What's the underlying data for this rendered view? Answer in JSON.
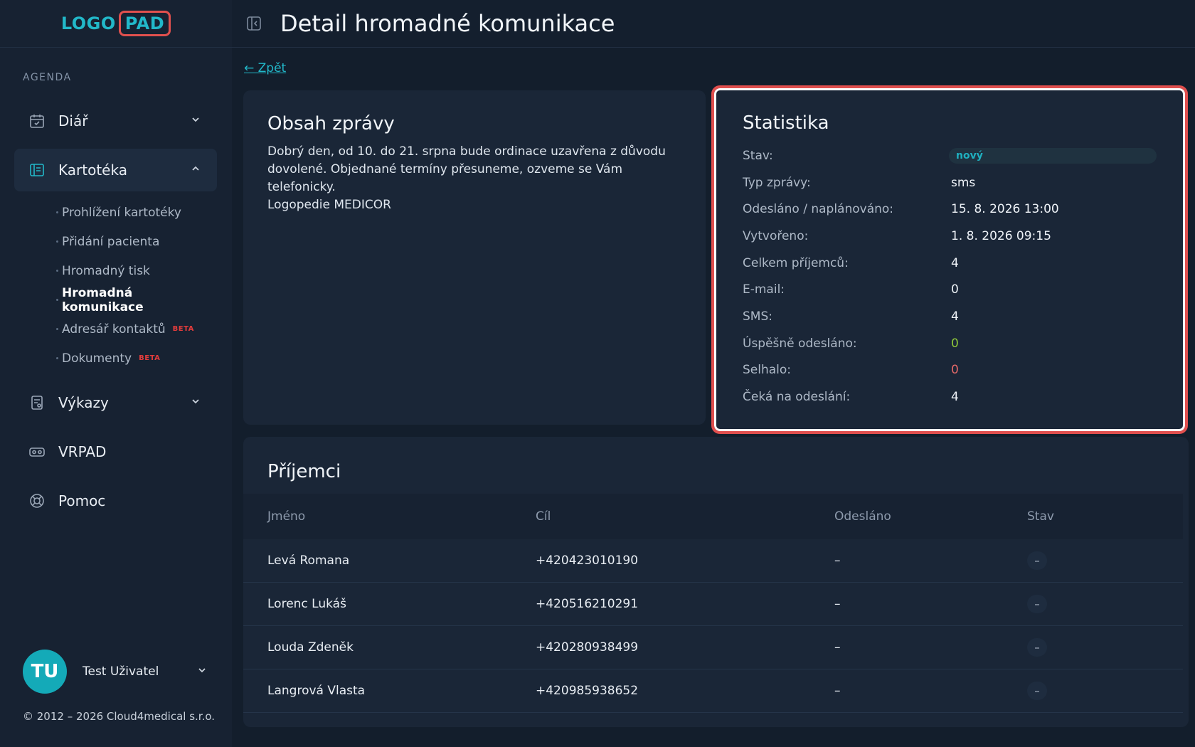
{
  "logo": {
    "left": "LOGO",
    "right": "PAD"
  },
  "sidebar": {
    "section_label": "AGENDA",
    "items": [
      {
        "label": "Diář",
        "icon": "calendar-icon"
      },
      {
        "label": "Kartotéka",
        "icon": "file-cabinet-icon"
      },
      {
        "label": "Výkazy",
        "icon": "report-icon"
      },
      {
        "label": "VRPAD",
        "icon": "vr-headset-icon"
      },
      {
        "label": "Pomoc",
        "icon": "lifebuoy-icon"
      }
    ],
    "subitems": [
      {
        "label": "Prohlížení kartotéky"
      },
      {
        "label": "Přidání pacienta"
      },
      {
        "label": "Hromadný tisk"
      },
      {
        "label": "Hromadná komunikace"
      },
      {
        "label": "Adresář kontaktů",
        "badge": "BETA"
      },
      {
        "label": "Dokumenty",
        "badge": "BETA"
      }
    ]
  },
  "user": {
    "initials": "TU",
    "name": "Test Uživatel"
  },
  "footer": "© 2012 – 2026 Cloud4medical s.r.o.",
  "header": {
    "title": "Detail hromadné komunikace"
  },
  "back": "← Zpět",
  "message": {
    "title": "Obsah zprávy",
    "body": "Dobrý den, od 10. do 21. srpna bude ordinace uzavřena z důvodu\ndovolené. Objednané termíny přesuneme, ozveme se Vám telefonicky.\nLogopedie MEDICOR"
  },
  "stats": {
    "title": "Statistika",
    "rows": [
      {
        "label": "Stav:",
        "value": "nový"
      },
      {
        "label": "Typ zprávy:",
        "value": "sms"
      },
      {
        "label": "Odesláno / naplánováno:",
        "value": "15. 8. 2026 13:00"
      },
      {
        "label": "Vytvořeno:",
        "value": "1. 8. 2026 09:15"
      },
      {
        "label": "Celkem příjemců:",
        "value": "4"
      },
      {
        "label": "E-mail:",
        "value": "0"
      },
      {
        "label": "SMS:",
        "value": "4"
      },
      {
        "label": "Úspěšně odesláno:",
        "value": "0"
      },
      {
        "label": "Selhalo:",
        "value": "0"
      },
      {
        "label": "Čeká na odeslání:",
        "value": "4"
      }
    ],
    "colors": {
      "success": "#8fc93a",
      "failed": "#e46868",
      "status_badge": "#1fb0c0"
    }
  },
  "recipients": {
    "title": "Příjemci",
    "columns": [
      "Jméno",
      "Cíl",
      "Odesláno",
      "Stav"
    ],
    "rows": [
      {
        "name": "Levá Romana",
        "target": "+420423010190",
        "sent": "–",
        "state": "–"
      },
      {
        "name": "Lorenc Lukáš",
        "target": "+420516210291",
        "sent": "–",
        "state": "–"
      },
      {
        "name": "Louda Zdeněk",
        "target": "+420280938499",
        "sent": "–",
        "state": "–"
      },
      {
        "name": "Langrová Vlasta",
        "target": "+420985938652",
        "sent": "–",
        "state": "–"
      }
    ]
  }
}
